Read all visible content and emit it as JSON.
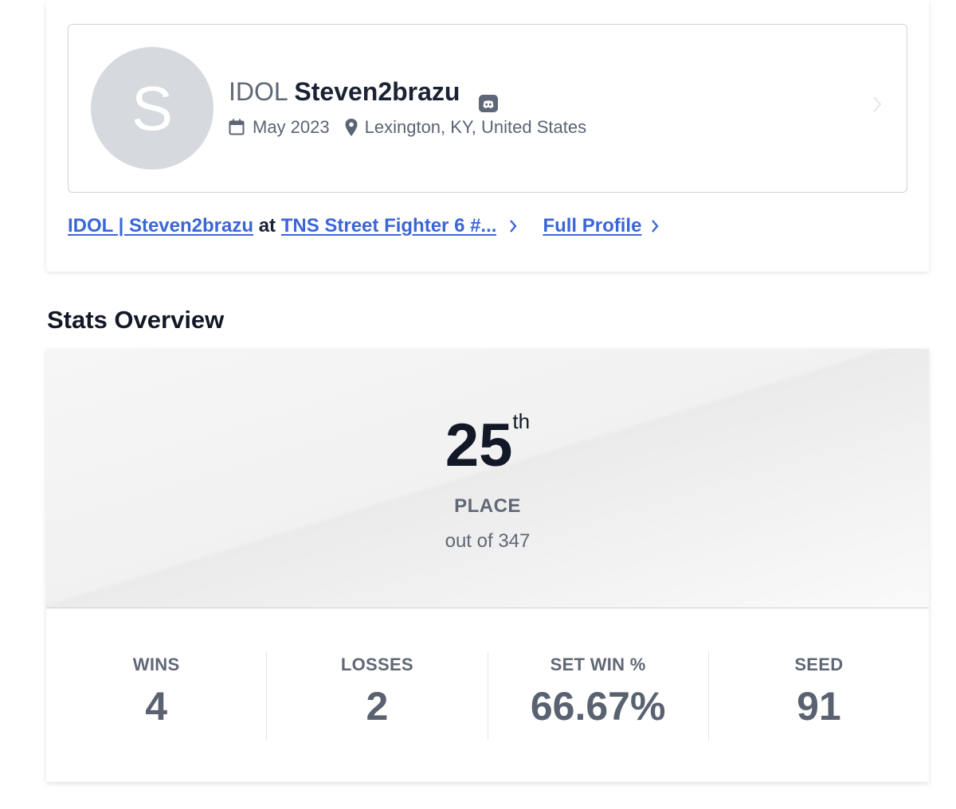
{
  "profile": {
    "avatar_letter": "S",
    "prefix": "IDOL",
    "gamertag": "Steven2brazu",
    "joined": "May 2023",
    "location": "Lexington, KY, United States",
    "icons": {
      "discord": "discord-icon",
      "calendar": "calendar-icon",
      "location": "location-pin-icon",
      "chevron": "chevron-right-icon"
    }
  },
  "links": {
    "entrant": "IDOL | Steven2brazu",
    "at": "at",
    "event": "TNS Street Fighter 6 #...",
    "full_profile": "Full Profile"
  },
  "stats_overview": {
    "title": "Stats Overview",
    "placement": "25",
    "placement_suffix": "th",
    "placement_label": "PLACE",
    "out_of": "out of 347",
    "items": [
      {
        "label": "WINS",
        "value": "4"
      },
      {
        "label": "LOSSES",
        "value": "2"
      },
      {
        "label": "SET WIN %",
        "value": "66.67%"
      },
      {
        "label": "SEED",
        "value": "91"
      }
    ]
  },
  "colors": {
    "link": "#3a66d8",
    "text_dark": "#1a2233",
    "text_muted": "#606775",
    "avatar_bg": "#d6d9de"
  }
}
